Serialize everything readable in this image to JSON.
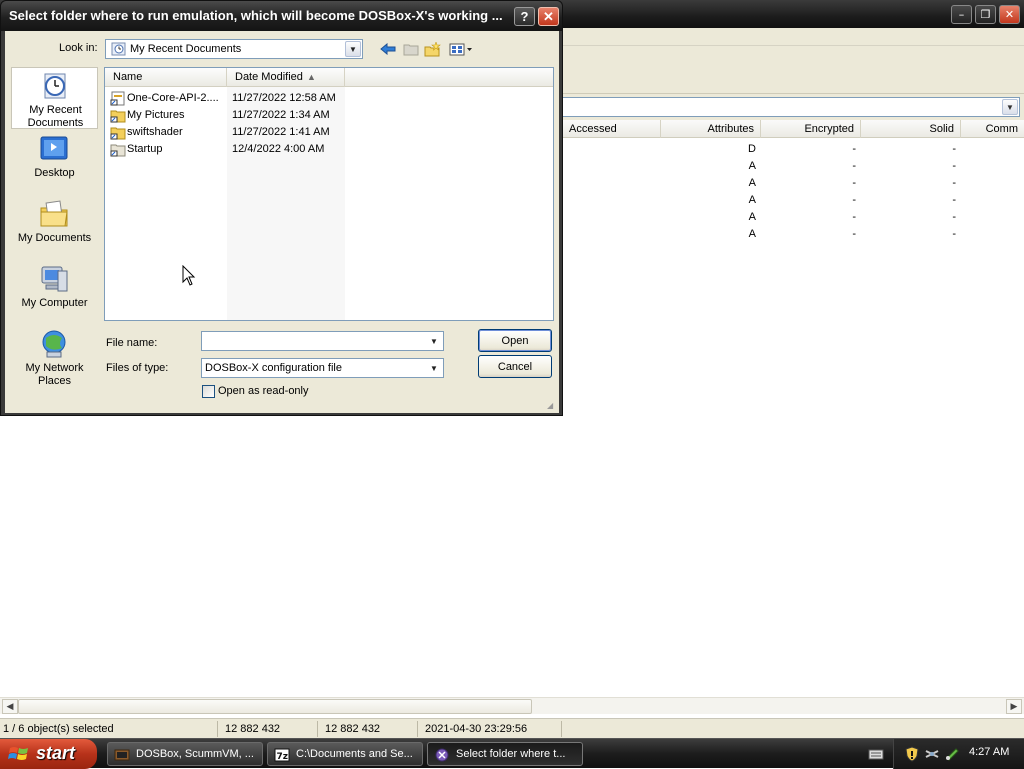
{
  "background_window": {
    "columns": [
      "Accessed",
      "Attributes",
      "Encrypted",
      "Solid",
      "Comm"
    ],
    "rows": [
      {
        "attributes": "D",
        "encrypted": "-",
        "solid": "-"
      },
      {
        "attributes": "A",
        "encrypted": "-",
        "solid": "-"
      },
      {
        "attributes": "A",
        "encrypted": "-",
        "solid": "-"
      },
      {
        "attributes": "A",
        "encrypted": "-",
        "solid": "-"
      },
      {
        "attributes": "A",
        "encrypted": "-",
        "solid": "-"
      },
      {
        "attributes": "A",
        "encrypted": "-",
        "solid": "-"
      }
    ],
    "status": {
      "selection": "1 / 6 object(s) selected",
      "size": "12 882 432",
      "packed_size": "12 882 432",
      "modified": "2021-04-30 23:29:56"
    },
    "window_buttons": {
      "minimize": "–",
      "restore": "❐",
      "close": "✕"
    }
  },
  "dialog": {
    "title": "Select folder where to run emulation, which will become DOSBox-X's working ...",
    "help": "?",
    "close": "✕",
    "look_in_label": "Look in:",
    "look_in_value": "My Recent Documents",
    "places": [
      {
        "label": "My Recent Documents",
        "icon": "recent-documents-icon"
      },
      {
        "label": "Desktop",
        "icon": "desktop-icon"
      },
      {
        "label": "My Documents",
        "icon": "my-documents-icon"
      },
      {
        "label": "My Computer",
        "icon": "my-computer-icon"
      },
      {
        "label": "My Network Places",
        "icon": "network-places-icon"
      }
    ],
    "columns": {
      "name": "Name",
      "date": "Date Modified"
    },
    "files": [
      {
        "name": "One-Core-API-2....",
        "date": "11/27/2022 12:58 AM"
      },
      {
        "name": "My Pictures",
        "date": "11/27/2022 1:34 AM"
      },
      {
        "name": "swiftshader",
        "date": "11/27/2022 1:41 AM"
      },
      {
        "name": "Startup",
        "date": "12/4/2022 4:00 AM"
      }
    ],
    "file_name_label": "File name:",
    "file_name_value": "",
    "files_of_type_label": "Files of type:",
    "files_of_type_value": "DOSBox-X configuration file",
    "read_only_label": "Open as read-only",
    "open_label": "Open",
    "cancel_label": "Cancel"
  },
  "taskbar": {
    "start_label": "start",
    "tasks": [
      {
        "label": "DOSBox, ScummVM, ..."
      },
      {
        "label": "C:\\Documents and Se..."
      },
      {
        "label": "Select folder where t..."
      }
    ],
    "clock": "4:27 AM"
  }
}
